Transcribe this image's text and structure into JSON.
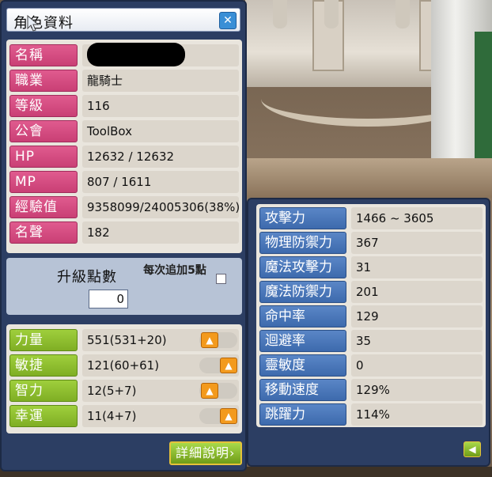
{
  "window": {
    "title": "角色資料",
    "close_icon": "close-icon"
  },
  "info": [
    {
      "label": "名稱",
      "value": ""
    },
    {
      "label": "職業",
      "value": "龍騎士"
    },
    {
      "label": "等級",
      "value": "116"
    },
    {
      "label": "公會",
      "value": "ToolBox"
    },
    {
      "label": "HP",
      "value": "12632 / 12632"
    },
    {
      "label": "MP",
      "value": "807 / 1611"
    },
    {
      "label": "經驗值",
      "value": "9358099/24005306(38%)"
    },
    {
      "label": "名聲",
      "value": "182"
    }
  ],
  "ap": {
    "label": "升級點數",
    "value": "0",
    "auto_label": "每次追加5點",
    "auto_checked": false
  },
  "stats": [
    {
      "label": "力量",
      "value": "551(531+20)"
    },
    {
      "label": "敏捷",
      "value": "121(60+61)"
    },
    {
      "label": "智力",
      "value": "12(5+7)"
    },
    {
      "label": "幸運",
      "value": "11(4+7)"
    }
  ],
  "detail_button": "詳細說明",
  "details": [
    {
      "label": "攻擊力",
      "value": "1466 ~ 3605"
    },
    {
      "label": "物理防禦力",
      "value": "367"
    },
    {
      "label": "魔法攻擊力",
      "value": "31"
    },
    {
      "label": "魔法防禦力",
      "value": "201"
    },
    {
      "label": "命中率",
      "value": "129"
    },
    {
      "label": "迴避率",
      "value": "35"
    },
    {
      "label": "靈敏度",
      "value": "0"
    },
    {
      "label": "移動速度",
      "value": "129%"
    },
    {
      "label": "跳躍力",
      "value": "114%"
    }
  ],
  "colors": {
    "info_label": "#d24a82",
    "stat_label": "#8fc030",
    "detail_label": "#4d7bbd",
    "window": "#2c3e63",
    "up_button": "#f39a1d"
  }
}
